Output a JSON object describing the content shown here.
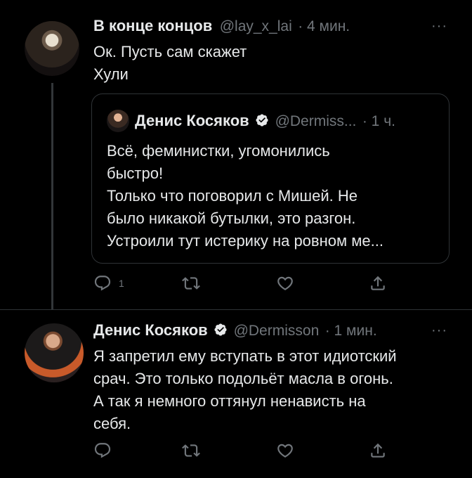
{
  "tweet1": {
    "author_name": "В конце концов",
    "handle": "@lay_x_lai",
    "time": "· 4 мин.",
    "more": "···",
    "text": "Ок. Пусть сам скажет\nХули",
    "quote": {
      "author_name": "Денис Косяков",
      "handle": "@Dermiss...",
      "time": "· 1 ч.",
      "text": "Всё, феминистки, угомонились\nбыстро!\nТолько что поговорил с Мишей. Не\nбыло никакой бутылки, это разгон.\nУстроили тут истерику на ровном ме..."
    },
    "actions": {
      "reply_count": "1"
    }
  },
  "tweet2": {
    "author_name": "Денис Косяков",
    "handle": "@Dermisson",
    "time": "· 1 мин.",
    "more": "···",
    "text": "Я запретил ему вступать в этот идиотский\nсрач. Это только подольёт масла в огонь.\nА так я немного оттянул ненависть на\nсебя."
  },
  "colors": {
    "background": "#000000",
    "text": "#e7e9ea",
    "secondary": "#71767b",
    "border": "#2f3336",
    "verified": "#e7e9ea"
  },
  "icons": [
    "reply-icon",
    "retweet-icon",
    "like-icon",
    "share-icon",
    "verified-icon"
  ]
}
